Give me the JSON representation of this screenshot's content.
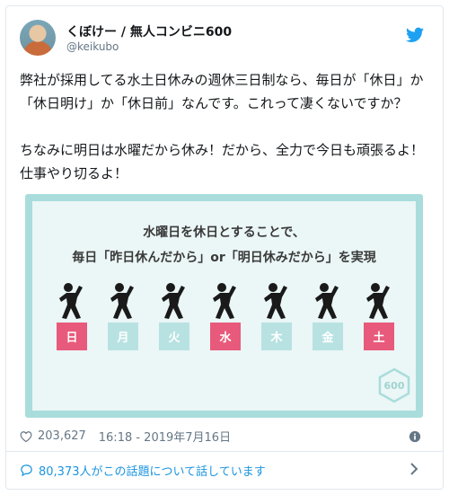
{
  "user": {
    "name": "くぼけー / 無人コンビニ600",
    "handle": "@keikubo"
  },
  "tweet": {
    "text": "弊社が採用してる水土日休みの週休三日制なら、毎日が「休日」か「休日明け」か「休日前」なんです。これって凄くないですか？\n\nちなみに明日は水曜だから休み！だから、全力で今日も頑張るよ！仕事やり切るよ！"
  },
  "media": {
    "headline_line1": "水曜日を休日とすることで、",
    "headline_line2": "毎日「昨日休んだから」or「明日休みだから」を実現",
    "days": [
      "日",
      "月",
      "火",
      "水",
      "木",
      "金",
      "土"
    ],
    "holiday_color": "#e85a7b",
    "workday_color": "#b8e2e2",
    "badge_text": "600"
  },
  "meta": {
    "likes": "203,627",
    "timestamp": "16:18 - 2019年7月16日"
  },
  "conversation": {
    "label": "80,373人がこの話題について話しています"
  },
  "colors": {
    "twitter_blue": "#1da1f2",
    "link_blue": "#1b95e0",
    "frame_teal": "#a9dddc"
  },
  "icons": {
    "brand": "twitter-bird-icon",
    "like": "heart-icon",
    "info": "info-icon",
    "conversation": "speech-bubble-icon",
    "chevron": "chevron-right-icon"
  }
}
